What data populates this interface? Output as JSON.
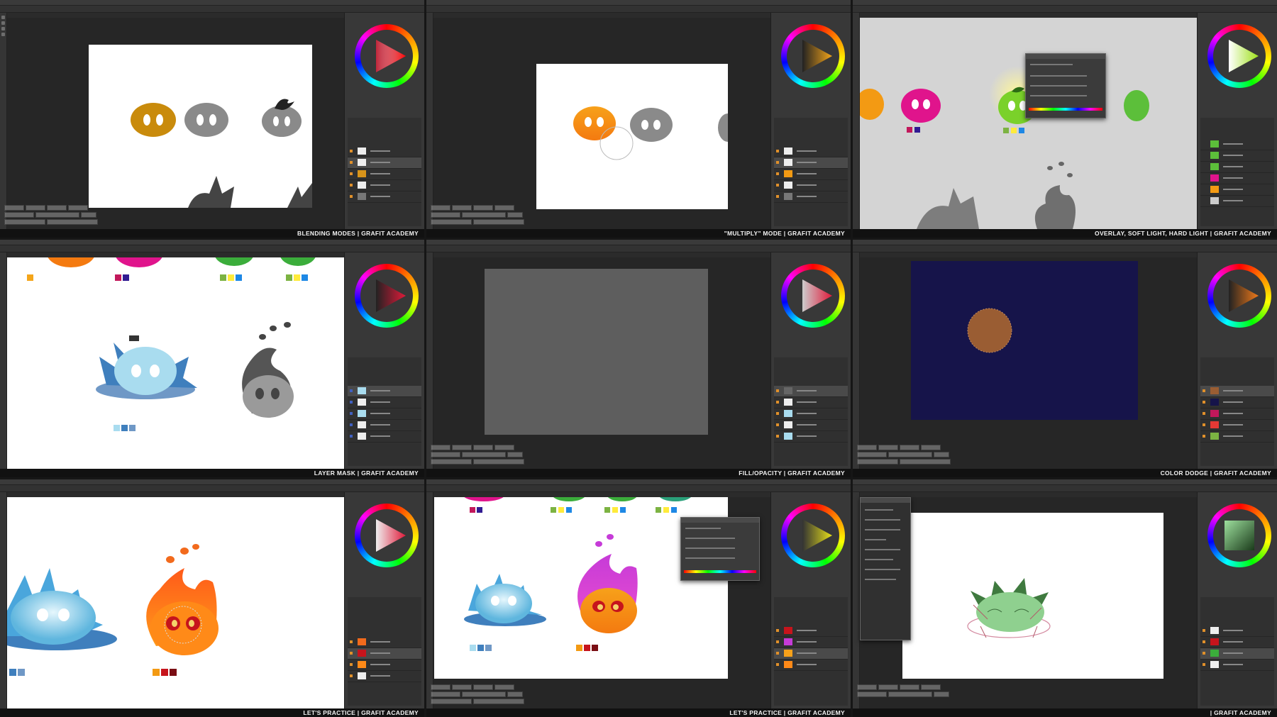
{
  "captions": [
    "BLENDING MODES | GRAFIT ACADEMY",
    "\"MULTIPLY\" MODE | GRAFIT ACADEMY",
    "OVERLAY, SOFT LIGHT, HARD LIGHT | GRAFIT ACADEMY",
    "LAYER MASK | GRAFIT ACADEMY",
    "FILL/OPACITY | GRAFIT ACADEMY",
    "COLOR DODGE | GRAFIT ACADEMY",
    "LET'S PRACTICE | GRAFIT ACADEMY",
    "LET'S PRACTICE | GRAFIT ACADEMY",
    "| GRAFIT ACADEMY"
  ],
  "colors": {
    "ui_dark": "#2b2b2b",
    "panel": "#383838",
    "slime_gold": "#c98b0c",
    "slime_gray": "#8a8a8a",
    "slime_orange": "#f39a13",
    "slime_magenta": "#e0148c",
    "slime_green": "#5cbf3a",
    "slime_blue": "#a9dcef",
    "night_blue": "#16144a",
    "brown_circle": "#9a5d33",
    "fire_orange": "#f26a1c",
    "fire_red": "#c6141c",
    "fire_purple": "#c63bd8"
  },
  "icons": [
    "move-icon",
    "brush-icon",
    "eraser-icon",
    "eyedropper-icon",
    "eye-icon",
    "color-wheel-icon"
  ]
}
